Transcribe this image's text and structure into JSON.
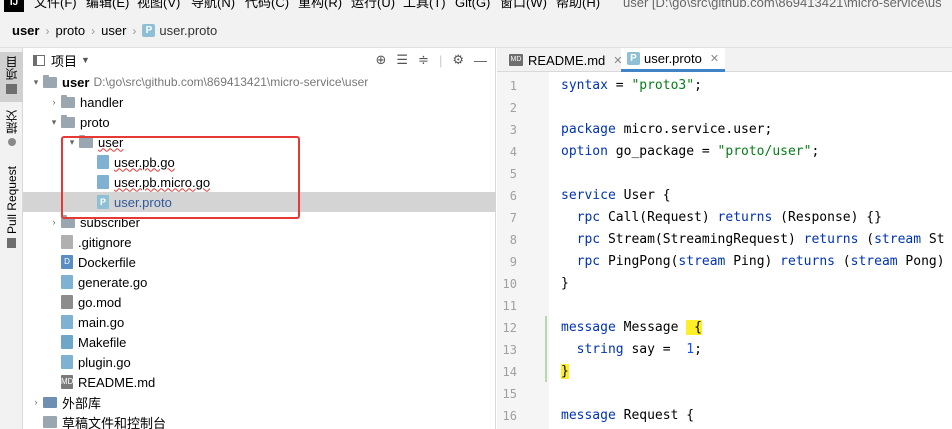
{
  "window": {
    "logo": "IJ",
    "menus": [
      "文件(F)",
      "编辑(E)",
      "视图(V)",
      "导航(N)",
      "代码(C)",
      "重构(R)",
      "运行(U)",
      "工具(T)",
      "Git(G)",
      "窗口(W)",
      "帮助(H)"
    ],
    "title": "user [D:\\go\\src\\github.com\\869413421\\micro-service\\us"
  },
  "breadcrumb": [
    "user",
    "proto",
    "user",
    "user.proto"
  ],
  "left_strip": {
    "tabs": [
      "项目",
      "提交",
      "Pull Request"
    ]
  },
  "project": {
    "title": "项目",
    "tree": [
      {
        "name": "user",
        "path": "D:\\go\\src\\github.com\\869413421\\micro-service\\user",
        "type": "folder",
        "expanded": true,
        "depth": 0
      },
      {
        "name": "handler",
        "type": "folder",
        "expanded": false,
        "depth": 1
      },
      {
        "name": "proto",
        "type": "folder",
        "expanded": true,
        "depth": 1
      },
      {
        "name": "user",
        "type": "folder",
        "expanded": true,
        "depth": 2,
        "error": true
      },
      {
        "name": "user.pb.go",
        "type": "go",
        "depth": 3,
        "error": true
      },
      {
        "name": "user.pb.micro.go",
        "type": "go",
        "depth": 3,
        "error": true
      },
      {
        "name": "user.proto",
        "type": "proto",
        "depth": 3,
        "selected": true
      },
      {
        "name": "subscriber",
        "type": "folder",
        "expanded": false,
        "depth": 1
      },
      {
        "name": ".gitignore",
        "type": "git",
        "depth": 1
      },
      {
        "name": "Dockerfile",
        "type": "docker",
        "depth": 1
      },
      {
        "name": "generate.go",
        "type": "go",
        "depth": 1
      },
      {
        "name": "go.mod",
        "type": "mod",
        "depth": 1
      },
      {
        "name": "main.go",
        "type": "go",
        "depth": 1
      },
      {
        "name": "Makefile",
        "type": "make",
        "depth": 1
      },
      {
        "name": "plugin.go",
        "type": "go",
        "depth": 1
      },
      {
        "name": "README.md",
        "type": "md",
        "depth": 1
      },
      {
        "name": "外部库",
        "type": "lib",
        "expanded": false,
        "depth": 0
      },
      {
        "name": "草稿文件和控制台",
        "type": "scratch",
        "depth": 0
      }
    ]
  },
  "editor": {
    "tabs": [
      {
        "label": "README.md",
        "icon": "MD"
      },
      {
        "label": "user.proto",
        "icon": "P",
        "active": true
      }
    ],
    "lines": [
      {
        "n": "1",
        "tokens": [
          [
            "kw",
            "syntax"
          ],
          [
            "",
            "="
          ],
          [
            "str",
            "\"proto3\""
          ],
          [
            "",
            ";"
          ]
        ]
      },
      {
        "n": "2",
        "tokens": []
      },
      {
        "n": "3",
        "tokens": [
          [
            "kw",
            "package"
          ],
          [
            "",
            "micro.service.user;"
          ]
        ]
      },
      {
        "n": "4",
        "tokens": [
          [
            "kw",
            "option"
          ],
          [
            "",
            "go_package ="
          ],
          [
            "str",
            "\"proto/user\""
          ],
          [
            "",
            ";"
          ]
        ]
      },
      {
        "n": "5",
        "tokens": []
      },
      {
        "n": "6",
        "tokens": [
          [
            "kw",
            "service"
          ],
          [
            "",
            "User {"
          ]
        ]
      },
      {
        "n": "7",
        "tokens": [
          [
            "",
            "  "
          ],
          [
            "kw",
            "rpc"
          ],
          [
            "",
            "Call(Request)"
          ],
          [
            "kw",
            "returns"
          ],
          [
            "",
            "(Response) {}"
          ]
        ]
      },
      {
        "n": "8",
        "tokens": [
          [
            "",
            "  "
          ],
          [
            "kw",
            "rpc"
          ],
          [
            "",
            "Stream(StreamingRequest)"
          ],
          [
            "kw",
            "returns"
          ],
          [
            "",
            "("
          ],
          [
            "kw",
            "stream"
          ],
          [
            "",
            "St"
          ]
        ]
      },
      {
        "n": "9",
        "tokens": [
          [
            "",
            "  "
          ],
          [
            "kw",
            "rpc"
          ],
          [
            "",
            "PingPong("
          ],
          [
            "kw",
            "stream"
          ],
          [
            "",
            "Ping)"
          ],
          [
            "kw",
            "returns"
          ],
          [
            "",
            "("
          ],
          [
            "kw",
            "stream"
          ],
          [
            "",
            "Pong)"
          ]
        ]
      },
      {
        "n": "10",
        "tokens": [
          [
            "",
            "}"
          ]
        ]
      },
      {
        "n": "11",
        "tokens": []
      },
      {
        "n": "12",
        "tokens": [
          [
            "kw",
            "message"
          ],
          [
            "",
            "Message "
          ],
          [
            "brace",
            "{"
          ]
        ]
      },
      {
        "n": "13",
        "tokens": [
          [
            "",
            "  "
          ],
          [
            "kw",
            "string"
          ],
          [
            "",
            "say = "
          ],
          [
            "num",
            "1"
          ],
          [
            "",
            ";"
          ]
        ]
      },
      {
        "n": "14",
        "tokens": [
          [
            "brace",
            "}"
          ]
        ]
      },
      {
        "n": "15",
        "tokens": []
      },
      {
        "n": "16",
        "tokens": [
          [
            "kw",
            "message"
          ],
          [
            "",
            "Request {"
          ]
        ]
      }
    ]
  }
}
